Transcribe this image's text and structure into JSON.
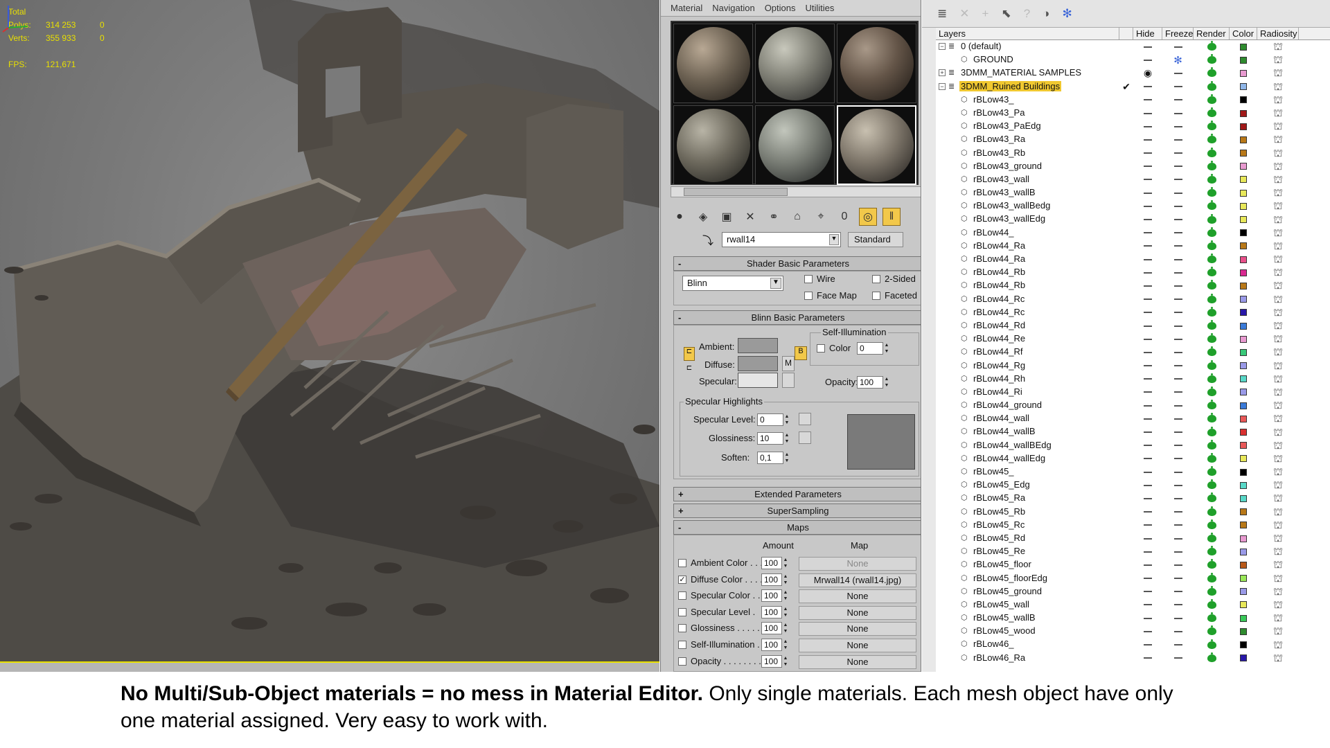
{
  "viewport": {
    "stats": [
      {
        "key": "Total",
        "value": "",
        "value2": ""
      },
      {
        "key": "Polys:",
        "value": "314 253",
        "value2": "0"
      },
      {
        "key": "Verts:",
        "value": "355 933",
        "value2": "0"
      },
      {
        "key": "FPS:",
        "value": "121,671",
        "value2": ""
      }
    ]
  },
  "material_editor": {
    "menu": [
      "Material",
      "Navigation",
      "Options",
      "Utilities"
    ],
    "material_name": "rwall14",
    "type_button": "Standard",
    "shader_rollout": "Shader Basic Parameters",
    "shader_type": "Blinn",
    "checks": {
      "wire": "Wire",
      "two_sided": "2-Sided",
      "face_map": "Face Map",
      "faceted": "Faceted"
    },
    "blinn_rollout": "Blinn Basic Parameters",
    "self_illum_group": "Self-Illumination",
    "self_illum_color_label": "Color",
    "self_illum_value": "0",
    "ambient_label": "Ambient:",
    "diffuse_label": "Diffuse:",
    "specular_label": "Specular:",
    "diffuse_map_btn": "M",
    "lock_btn": "B",
    "opacity_label": "Opacity:",
    "opacity_value": "100",
    "spec_group": "Specular Highlights",
    "spec_level_label": "Specular Level:",
    "spec_level_value": "0",
    "gloss_label": "Glossiness:",
    "gloss_value": "10",
    "soften_label": "Soften:",
    "soften_value": "0,1",
    "extended_rollout": "Extended Parameters",
    "supersampling_rollout": "SuperSampling",
    "maps_rollout": "Maps",
    "maps_amount_header": "Amount",
    "maps_map_header": "Map",
    "maps": [
      {
        "label": "Ambient Color . . .",
        "amount": "100",
        "map": "None",
        "checked": false,
        "active": false
      },
      {
        "label": "Diffuse Color . . . .",
        "amount": "100",
        "map": "Mrwall14 (rwall14.jpg)",
        "checked": true,
        "active": true
      },
      {
        "label": "Specular Color . .",
        "amount": "100",
        "map": "None",
        "checked": false,
        "active": true
      },
      {
        "label": "Specular Level .",
        "amount": "100",
        "map": "None",
        "checked": false,
        "active": true
      },
      {
        "label": "Glossiness . . . . .",
        "amount": "100",
        "map": "None",
        "checked": false,
        "active": true
      },
      {
        "label": "Self-Illumination .",
        "amount": "100",
        "map": "None",
        "checked": false,
        "active": true
      },
      {
        "label": "Opacity . . . . . . . .",
        "amount": "100",
        "map": "None",
        "checked": false,
        "active": true
      }
    ]
  },
  "layer_manager": {
    "columns": [
      "Layers",
      "Hide",
      "Freeze",
      "Render",
      "Color",
      "Radiosity"
    ],
    "layers": [
      {
        "name": "0 (default)",
        "level": 0,
        "expander": "-",
        "color": "#2e8b2e",
        "freeze": "dash",
        "hide": "dash",
        "current": false,
        "selected": false
      },
      {
        "name": "GROUND",
        "level": 1,
        "expander": "",
        "color": "#2e8b2e",
        "freeze": "snow",
        "hide": "dash",
        "current": false,
        "selected": false
      },
      {
        "name": "3DMM_MATERIAL SAMPLES",
        "level": 0,
        "expander": "+",
        "color": "#e89ad0",
        "freeze": "dash",
        "hide": "hidden",
        "current": false,
        "selected": false
      },
      {
        "name": "3DMM_Ruined Buildings",
        "level": 0,
        "expander": "-",
        "color": "#8fb6e8",
        "freeze": "dash",
        "hide": "dash",
        "current": true,
        "selected": true
      },
      {
        "name": "rBLow43_",
        "level": 1,
        "color": "#000000"
      },
      {
        "name": "rBLow43_Pa",
        "level": 1,
        "color": "#a01818"
      },
      {
        "name": "rBLow43_PaEdg",
        "level": 1,
        "color": "#a01818"
      },
      {
        "name": "rBLow43_Ra",
        "level": 1,
        "color": "#b87818"
      },
      {
        "name": "rBLow43_Rb",
        "level": 1,
        "color": "#b87818"
      },
      {
        "name": "rBLow43_ground",
        "level": 1,
        "color": "#e89ad0"
      },
      {
        "name": "rBLow43_wall",
        "level": 1,
        "color": "#e8e85a"
      },
      {
        "name": "rBLow43_wallB",
        "level": 1,
        "color": "#e8e85a"
      },
      {
        "name": "rBLow43_wallBedg",
        "level": 1,
        "color": "#e8e85a"
      },
      {
        "name": "rBLow43_wallEdg",
        "level": 1,
        "color": "#e8e85a"
      },
      {
        "name": "rBLow44_",
        "level": 1,
        "color": "#000000"
      },
      {
        "name": "rBLow44_Ra",
        "level": 1,
        "color": "#b87818"
      },
      {
        "name": "rBLow44_Ra",
        "level": 1,
        "color": "#e8508a"
      },
      {
        "name": "rBLow44_Rb",
        "level": 1,
        "color": "#d82890"
      },
      {
        "name": "rBLow44_Rb",
        "level": 1,
        "color": "#b87818"
      },
      {
        "name": "rBLow44_Rc",
        "level": 1,
        "color": "#9a9ae8"
      },
      {
        "name": "rBLow44_Rc",
        "level": 1,
        "color": "#2818a8"
      },
      {
        "name": "rBLow44_Rd",
        "level": 1,
        "color": "#3a7ad8"
      },
      {
        "name": "rBLow44_Re",
        "level": 1,
        "color": "#e89ad0"
      },
      {
        "name": "rBLow44_Rf",
        "level": 1,
        "color": "#38c878"
      },
      {
        "name": "rBLow44_Rg",
        "level": 1,
        "color": "#9a9ae8"
      },
      {
        "name": "rBLow44_Rh",
        "level": 1,
        "color": "#58d8c8"
      },
      {
        "name": "rBLow44_Ri",
        "level": 1,
        "color": "#9a9ae8"
      },
      {
        "name": "rBLow44_ground",
        "level": 1,
        "color": "#3a7ad8"
      },
      {
        "name": "rBLow44_wall",
        "level": 1,
        "color": "#e85858"
      },
      {
        "name": "rBLow44_wallB",
        "level": 1,
        "color": "#d83030"
      },
      {
        "name": "rBLow44_wallBEdg",
        "level": 1,
        "color": "#e85858"
      },
      {
        "name": "rBLow44_wallEdg",
        "level": 1,
        "color": "#e8e85a"
      },
      {
        "name": "rBLow45_",
        "level": 1,
        "color": "#000000"
      },
      {
        "name": "rBLow45_Edg",
        "level": 1,
        "color": "#58d8c8"
      },
      {
        "name": "rBLow45_Ra",
        "level": 1,
        "color": "#58d8c8"
      },
      {
        "name": "rBLow45_Rb",
        "level": 1,
        "color": "#b87818"
      },
      {
        "name": "rBLow45_Rc",
        "level": 1,
        "color": "#b87818"
      },
      {
        "name": "rBLow45_Rd",
        "level": 1,
        "color": "#e89ad0"
      },
      {
        "name": "rBLow45_Re",
        "level": 1,
        "color": "#9a9ae8"
      },
      {
        "name": "rBLow45_floor",
        "level": 1,
        "color": "#b85818"
      },
      {
        "name": "rBLow45_floorEdg",
        "level": 1,
        "color": "#9ae858"
      },
      {
        "name": "rBLow45_ground",
        "level": 1,
        "color": "#9a9ae8"
      },
      {
        "name": "rBLow45_wall",
        "level": 1,
        "color": "#e8e85a"
      },
      {
        "name": "rBLow45_wallB",
        "level": 1,
        "color": "#38c858"
      },
      {
        "name": "rBLow45_wood",
        "level": 1,
        "color": "#2e8b2e"
      },
      {
        "name": "rBLow46_",
        "level": 1,
        "color": "#000000"
      },
      {
        "name": "rBLow46_Ra",
        "level": 1,
        "color": "#2818a8"
      }
    ]
  },
  "caption": {
    "bold": "No Multi/Sub-Object materials = no mess in Material Editor.",
    "rest": " Only single materials. Each mesh object have only one material assigned. Very easy to work with."
  }
}
